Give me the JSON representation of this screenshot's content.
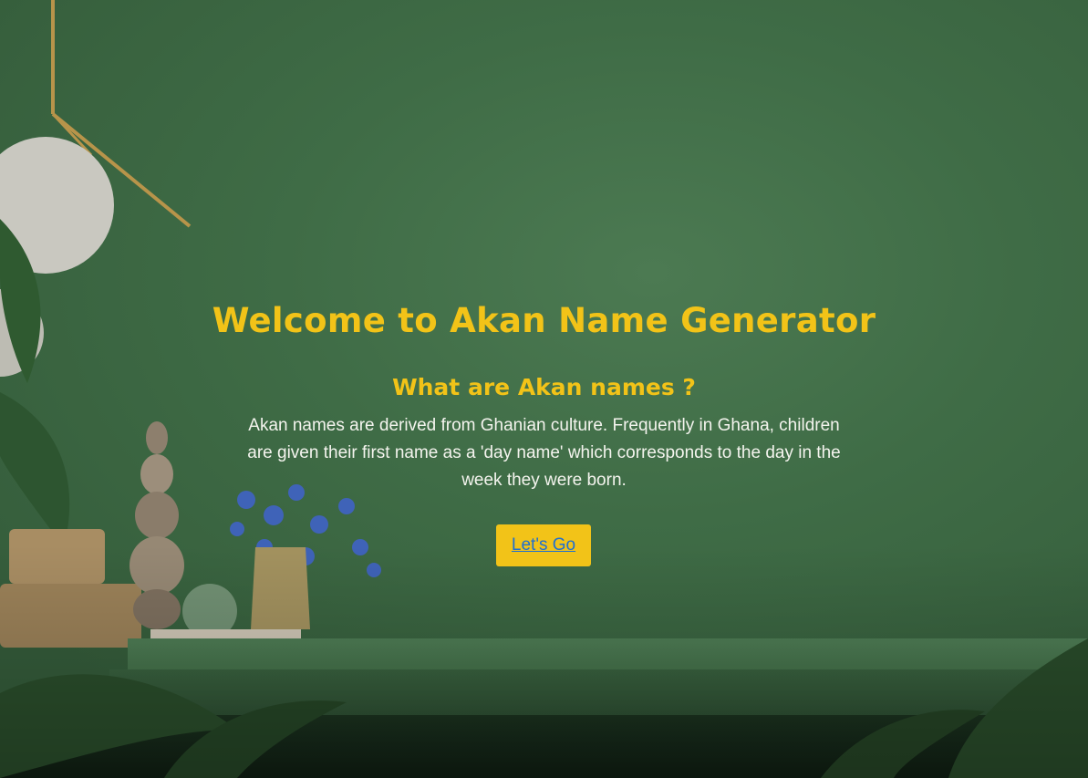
{
  "hero": {
    "title": "Welcome to Akan Name Generator",
    "subtitle": "What are Akan names ?",
    "description": "Akan names are derived from Ghanian culture. Frequently in Ghana, children are given their first name as a 'day name' which corresponds to the day in the week they were born.",
    "cta_label": "Let's Go"
  },
  "colors": {
    "accent": "#f2c318",
    "link": "#1f6fd1",
    "background": "#426f48",
    "body_text": "#f4f4ee"
  }
}
